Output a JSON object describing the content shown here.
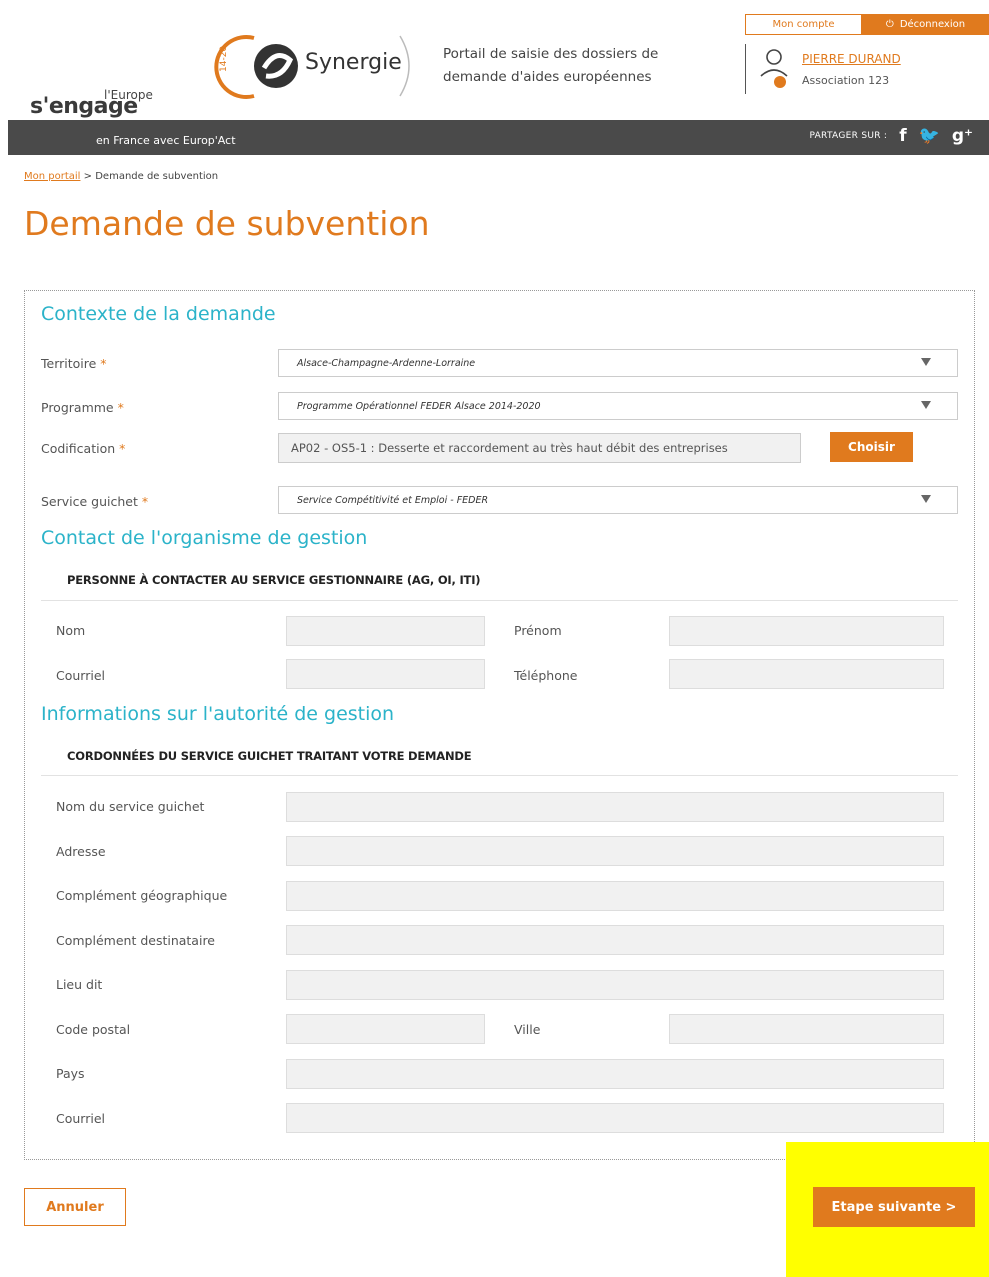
{
  "header": {
    "europe_small": "l'Europe",
    "sengage": "s'engage",
    "synergie": "Synergie",
    "synergie_badge": "14-20",
    "tagline": "Portail de saisie des dossiers de demande d'aides européennes",
    "bar_text": "en France avec Europ'Act",
    "account_label": "Mon compte",
    "logout_label": "Déconnexion",
    "user_name": "PIERRE DURAND",
    "user_org": "Association 123",
    "share_label": "PARTAGER SUR :",
    "share_icons": [
      "f",
      "✔",
      "g⁺"
    ]
  },
  "breadcrumb": {
    "home": "Mon portail",
    "separator": ">",
    "current": "Demande de subvention"
  },
  "page_title": "Demande de subvention",
  "form": {
    "section1": {
      "title": "Contexte de la demande",
      "territoire_label": "Territoire",
      "territoire_value": "Alsace-Champagne-Ardenne-Lorraine",
      "programme_label": "Programme",
      "programme_value": "Programme Opérationnel FEDER Alsace 2014-2020",
      "codification_label": "Codification",
      "codification_value": "AP02 - OS5-1 : Desserte et raccordement au très haut débit des entreprises",
      "choose_label": "Choisir",
      "service_label": "Service guichet",
      "service_value": "Service Compétitivité et Emploi - FEDER",
      "required_mark": "*"
    },
    "section2": {
      "title": "Contact de l'organisme de gestion",
      "subheading": "PERSONNE À CONTACTER AU SERVICE GESTIONNAIRE (AG, OI, ITI)",
      "nom": "Nom",
      "prenom": "Prénom",
      "courriel": "Courriel",
      "telephone": "Téléphone"
    },
    "section3": {
      "title": "Informations sur l'autorité de gestion",
      "subheading": "CORDONNÉES DU SERVICE GUICHET TRAITANT VOTRE DEMANDE",
      "nom_service": "Nom du service guichet",
      "adresse": "Adresse",
      "complement_geo": "Complément géographique",
      "complement_dest": "Complément destinataire",
      "lieu_dit": "Lieu dit",
      "code_postal": "Code postal",
      "ville": "Ville",
      "pays": "Pays",
      "courriel": "Courriel"
    }
  },
  "actions": {
    "cancel": "Annuler",
    "next": "Etape suivante >"
  },
  "colors": {
    "accent": "#e07a1e",
    "section": "#2bb3c9",
    "bar": "#4a4a4a",
    "highlight": "#ffff00"
  }
}
